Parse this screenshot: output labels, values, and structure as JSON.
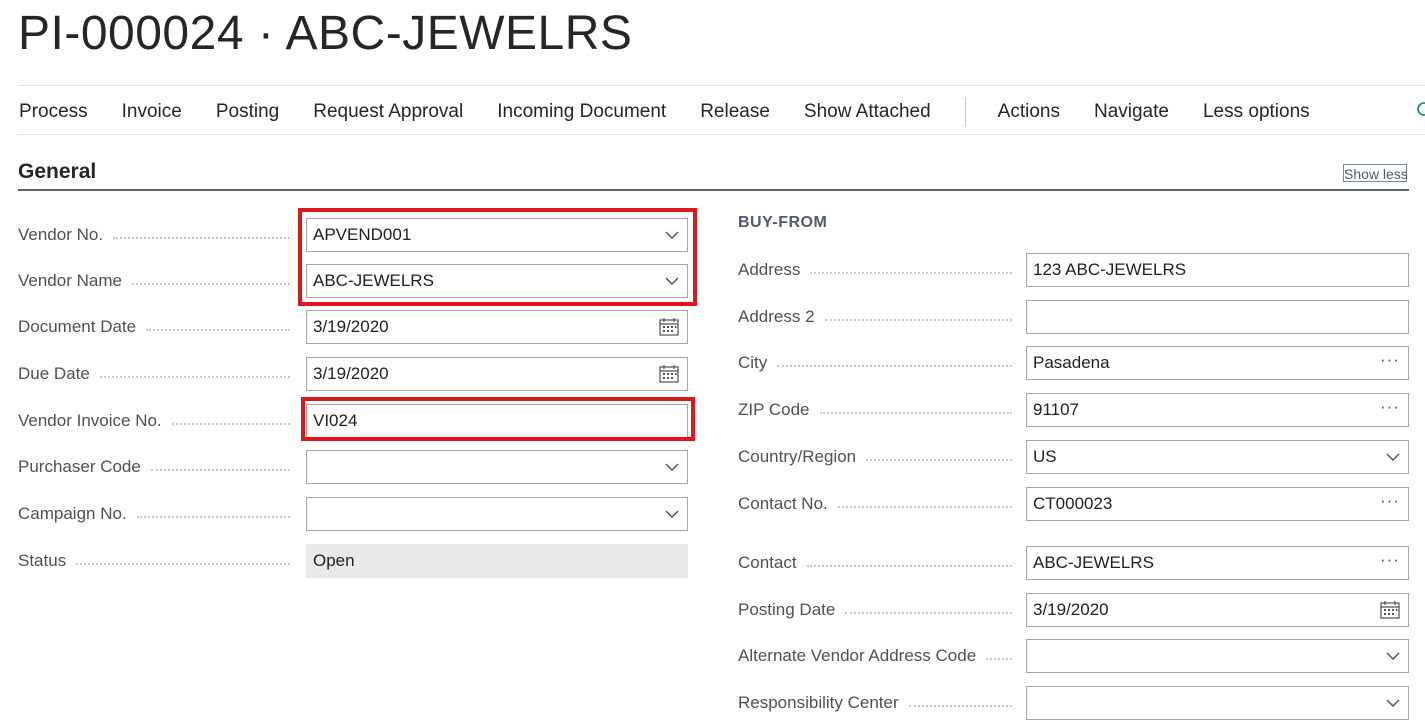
{
  "page": {
    "title": "PI-000024 · ABC-JEWELRS"
  },
  "action_bar": {
    "items": [
      "Process",
      "Invoice",
      "Posting",
      "Request Approval",
      "Incoming Document",
      "Release",
      "Show Attached"
    ],
    "secondary_items": [
      "Actions",
      "Navigate",
      "Less options"
    ]
  },
  "section": {
    "title": "General",
    "show_less_label": "Show less"
  },
  "left_fields": [
    {
      "label": "Vendor No.",
      "value": "APVEND001",
      "icon": "chevron-down-icon"
    },
    {
      "label": "Vendor Name",
      "value": "ABC-JEWELRS",
      "icon": "chevron-down-icon"
    },
    {
      "label": "Document Date",
      "value": "3/19/2020",
      "icon": "calendar-icon"
    },
    {
      "label": "Due Date",
      "value": "3/19/2020",
      "icon": "calendar-icon"
    },
    {
      "label": "Vendor Invoice No.",
      "value": "VI024",
      "icon": ""
    },
    {
      "label": "Purchaser Code",
      "value": "",
      "icon": "chevron-down-icon"
    },
    {
      "label": "Campaign No.",
      "value": "",
      "icon": "chevron-down-icon"
    },
    {
      "label": "Status",
      "value": "Open",
      "icon": ""
    }
  ],
  "buy_from": {
    "title": "BUY-FROM",
    "fields": [
      {
        "label": "Address",
        "value": "123 ABC-JEWELRS",
        "icon": ""
      },
      {
        "label": "Address 2",
        "value": "",
        "icon": ""
      },
      {
        "label": "City",
        "value": "Pasadena",
        "icon": "ellipsis-icon"
      },
      {
        "label": "ZIP Code",
        "value": "91107",
        "icon": "ellipsis-icon"
      },
      {
        "label": "Country/Region",
        "value": "US",
        "icon": "chevron-down-icon"
      },
      {
        "label": "Contact No.",
        "value": "CT000023",
        "icon": "ellipsis-icon"
      },
      {
        "label": "Contact",
        "value": "ABC-JEWELRS",
        "icon": "ellipsis-icon"
      },
      {
        "label": "Posting Date",
        "value": "3/19/2020",
        "icon": "calendar-icon"
      },
      {
        "label": "Alternate Vendor Address Code",
        "value": "",
        "icon": "chevron-down-icon"
      },
      {
        "label": "Responsibility Center",
        "value": "",
        "icon": "chevron-down-icon"
      }
    ]
  },
  "colors": {
    "highlight": "#e0161d",
    "accent": "#0078d4",
    "readonly_bg": "#e8e9ea"
  }
}
